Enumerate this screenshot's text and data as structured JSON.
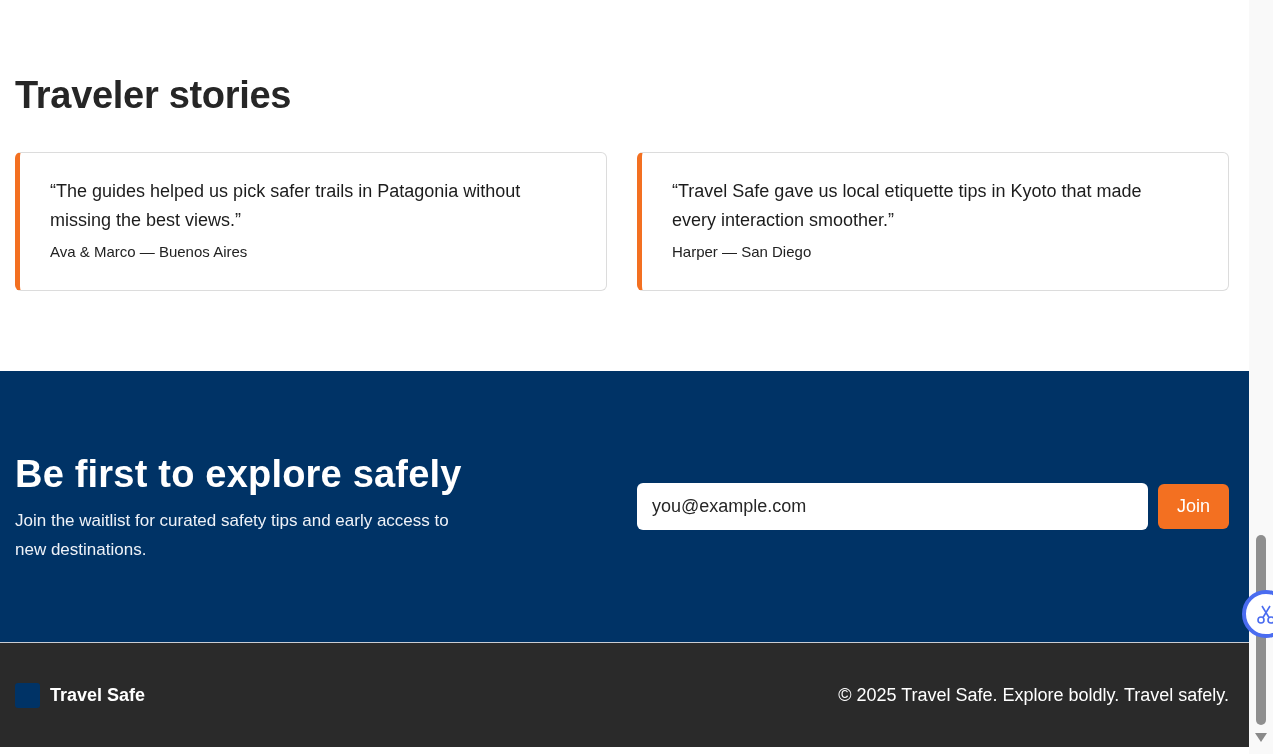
{
  "stories": {
    "title": "Traveler stories",
    "testimonials": [
      {
        "quote": "“The guides helped us pick safer trails in Patagonia without missing the best views.”",
        "author": "Ava & Marco — Buenos Aires"
      },
      {
        "quote": "“Travel Safe gave us local etiquette tips in Kyoto that made every interaction smoother.”",
        "author": "Harper — San Diego"
      }
    ]
  },
  "waitlist": {
    "title": "Be first to explore safely",
    "text": "Join the waitlist for curated safety tips and early access to new destinations.",
    "email_field": {
      "placeholder": "you@example.com"
    },
    "button": "Join"
  },
  "footer": {
    "brand": "Travel Safe",
    "copyright": "© 2025 Travel Safe. Explore boldly. Travel safely."
  }
}
